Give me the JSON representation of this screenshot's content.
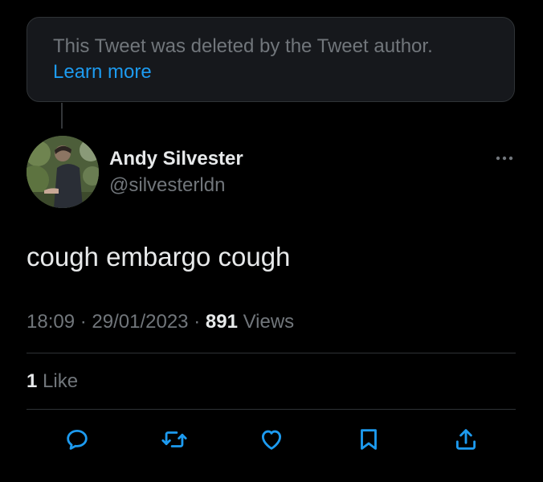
{
  "deleted_notice": {
    "message": "This Tweet was deleted by the Tweet author.",
    "link_label": "Learn more"
  },
  "author": {
    "name": "Andy Silvester",
    "handle": "@silvesterldn"
  },
  "tweet": {
    "text": "cough embargo cough",
    "time": "18:09",
    "separator": "·",
    "date": "29/01/2023",
    "views_count": "891",
    "views_label": "Views"
  },
  "engagement": {
    "likes_count": "1",
    "likes_label": "Like"
  },
  "actions": [
    {
      "icon": "reply-icon"
    },
    {
      "icon": "retweet-icon"
    },
    {
      "icon": "like-heart-icon"
    },
    {
      "icon": "bookmark-icon"
    },
    {
      "icon": "share-icon"
    }
  ],
  "colors": {
    "background": "#000000",
    "card": "#16181c",
    "primary_text": "#e7e9ea",
    "secondary_text": "#71767b",
    "link": "#1d9bf0",
    "border": "#2f3336"
  }
}
